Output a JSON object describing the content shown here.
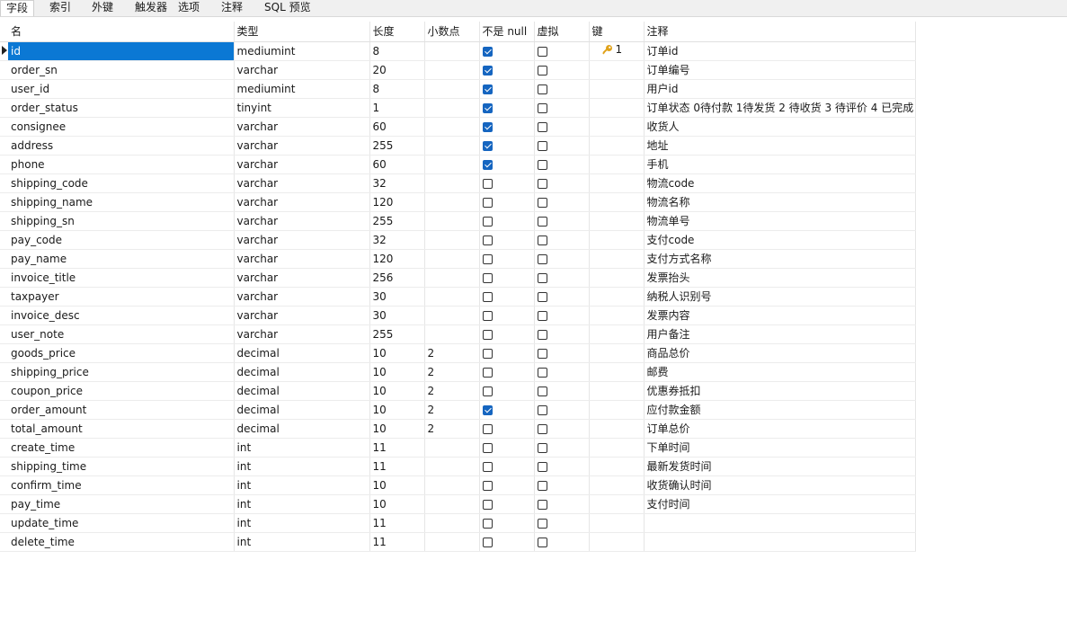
{
  "tabs": [
    {
      "label": "字段",
      "active": true
    },
    {
      "label": "索引",
      "active": false
    },
    {
      "label": "外键",
      "active": false
    },
    {
      "label": "触发器",
      "active": false
    },
    {
      "label": "选项",
      "active": false
    },
    {
      "label": "注释",
      "active": false
    },
    {
      "label": "SQL 预览",
      "active": false
    }
  ],
  "columns": {
    "name": "名",
    "type": "类型",
    "length": "长度",
    "decimals": "小数点",
    "not_null": "不是 null",
    "virtual": "虚拟",
    "key": "键",
    "comment": "注释"
  },
  "rows": [
    {
      "name": "id",
      "type": "mediumint",
      "length": "8",
      "decimals": "",
      "not_null": true,
      "virtual": false,
      "key": "1",
      "comment": "订单id"
    },
    {
      "name": "order_sn",
      "type": "varchar",
      "length": "20",
      "decimals": "",
      "not_null": true,
      "virtual": false,
      "key": "",
      "comment": "订单编号"
    },
    {
      "name": "user_id",
      "type": "mediumint",
      "length": "8",
      "decimals": "",
      "not_null": true,
      "virtual": false,
      "key": "",
      "comment": "用户id"
    },
    {
      "name": "order_status",
      "type": "tinyint",
      "length": "1",
      "decimals": "",
      "not_null": true,
      "virtual": false,
      "key": "",
      "comment": "订单状态 0待付款 1待发货 2 待收货 3 待评价 4 已完成"
    },
    {
      "name": "consignee",
      "type": "varchar",
      "length": "60",
      "decimals": "",
      "not_null": true,
      "virtual": false,
      "key": "",
      "comment": "收货人"
    },
    {
      "name": "address",
      "type": "varchar",
      "length": "255",
      "decimals": "",
      "not_null": true,
      "virtual": false,
      "key": "",
      "comment": "地址"
    },
    {
      "name": "phone",
      "type": "varchar",
      "length": "60",
      "decimals": "",
      "not_null": true,
      "virtual": false,
      "key": "",
      "comment": "手机"
    },
    {
      "name": "shipping_code",
      "type": "varchar",
      "length": "32",
      "decimals": "",
      "not_null": false,
      "virtual": false,
      "key": "",
      "comment": "物流code"
    },
    {
      "name": "shipping_name",
      "type": "varchar",
      "length": "120",
      "decimals": "",
      "not_null": false,
      "virtual": false,
      "key": "",
      "comment": "物流名称"
    },
    {
      "name": "shipping_sn",
      "type": "varchar",
      "length": "255",
      "decimals": "",
      "not_null": false,
      "virtual": false,
      "key": "",
      "comment": "物流单号"
    },
    {
      "name": "pay_code",
      "type": "varchar",
      "length": "32",
      "decimals": "",
      "not_null": false,
      "virtual": false,
      "key": "",
      "comment": "支付code"
    },
    {
      "name": "pay_name",
      "type": "varchar",
      "length": "120",
      "decimals": "",
      "not_null": false,
      "virtual": false,
      "key": "",
      "comment": "支付方式名称"
    },
    {
      "name": "invoice_title",
      "type": "varchar",
      "length": "256",
      "decimals": "",
      "not_null": false,
      "virtual": false,
      "key": "",
      "comment": "发票抬头"
    },
    {
      "name": "taxpayer",
      "type": "varchar",
      "length": "30",
      "decimals": "",
      "not_null": false,
      "virtual": false,
      "key": "",
      "comment": "纳税人识别号"
    },
    {
      "name": "invoice_desc",
      "type": "varchar",
      "length": "30",
      "decimals": "",
      "not_null": false,
      "virtual": false,
      "key": "",
      "comment": "发票内容"
    },
    {
      "name": "user_note",
      "type": "varchar",
      "length": "255",
      "decimals": "",
      "not_null": false,
      "virtual": false,
      "key": "",
      "comment": "用户备注"
    },
    {
      "name": "goods_price",
      "type": "decimal",
      "length": "10",
      "decimals": "2",
      "not_null": false,
      "virtual": false,
      "key": "",
      "comment": "商品总价"
    },
    {
      "name": "shipping_price",
      "type": "decimal",
      "length": "10",
      "decimals": "2",
      "not_null": false,
      "virtual": false,
      "key": "",
      "comment": "邮费"
    },
    {
      "name": "coupon_price",
      "type": "decimal",
      "length": "10",
      "decimals": "2",
      "not_null": false,
      "virtual": false,
      "key": "",
      "comment": "优惠券抵扣"
    },
    {
      "name": "order_amount",
      "type": "decimal",
      "length": "10",
      "decimals": "2",
      "not_null": true,
      "virtual": false,
      "key": "",
      "comment": "应付款金额"
    },
    {
      "name": "total_amount",
      "type": "decimal",
      "length": "10",
      "decimals": "2",
      "not_null": false,
      "virtual": false,
      "key": "",
      "comment": "订单总价"
    },
    {
      "name": "create_time",
      "type": "int",
      "length": "11",
      "decimals": "",
      "not_null": false,
      "virtual": false,
      "key": "",
      "comment": "下单时间"
    },
    {
      "name": "shipping_time",
      "type": "int",
      "length": "11",
      "decimals": "",
      "not_null": false,
      "virtual": false,
      "key": "",
      "comment": "最新发货时间"
    },
    {
      "name": "confirm_time",
      "type": "int",
      "length": "10",
      "decimals": "",
      "not_null": false,
      "virtual": false,
      "key": "",
      "comment": "收货确认时间"
    },
    {
      "name": "pay_time",
      "type": "int",
      "length": "10",
      "decimals": "",
      "not_null": false,
      "virtual": false,
      "key": "",
      "comment": "支付时间"
    },
    {
      "name": "update_time",
      "type": "int",
      "length": "11",
      "decimals": "",
      "not_null": false,
      "virtual": false,
      "key": "",
      "comment": ""
    },
    {
      "name": "delete_time",
      "type": "int",
      "length": "11",
      "decimals": "",
      "not_null": false,
      "virtual": false,
      "key": "",
      "comment": ""
    }
  ],
  "selected_row": 0,
  "colors": {
    "selection": "#0b78d4",
    "checkbox_checked": "#1565c0",
    "key_icon": "#e0a21a"
  },
  "icons": {
    "row_pointer": "row-pointer-icon",
    "primary_key": "key-icon"
  }
}
